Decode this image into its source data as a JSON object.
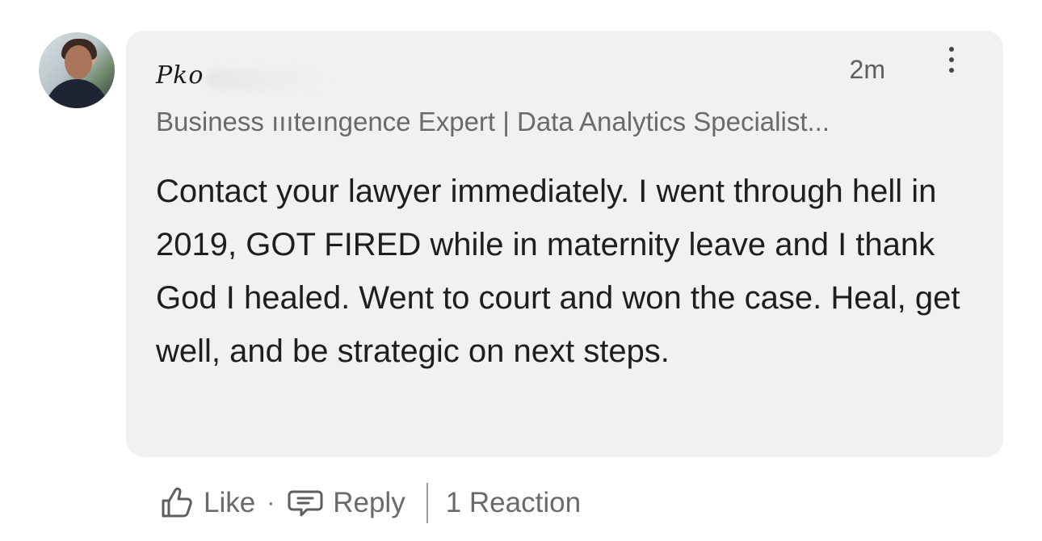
{
  "comment": {
    "author_name": "Pko",
    "author_headline": "Business ıııteıngence Expert | Data Analytics Specialist...",
    "timestamp": "2m",
    "text": "Contact your lawyer immediately. I went through hell in 2019, GOT FIRED while in maternity leave and I thank God I healed. Went to court and won the case. Heal, get well, and be strategic on next steps.",
    "more_icon": "more-vertical-icon"
  },
  "actions": {
    "like_label": "Like",
    "like_icon": "thumbs-up-icon",
    "separator": "·",
    "reply_label": "Reply",
    "reply_icon": "speech-bubble-icon",
    "reactions_label": "1 Reaction"
  },
  "colors": {
    "bubble_bg": "#f2f1ef",
    "text_primary": "#1e1e1e",
    "text_secondary": "#6a6a6a"
  }
}
